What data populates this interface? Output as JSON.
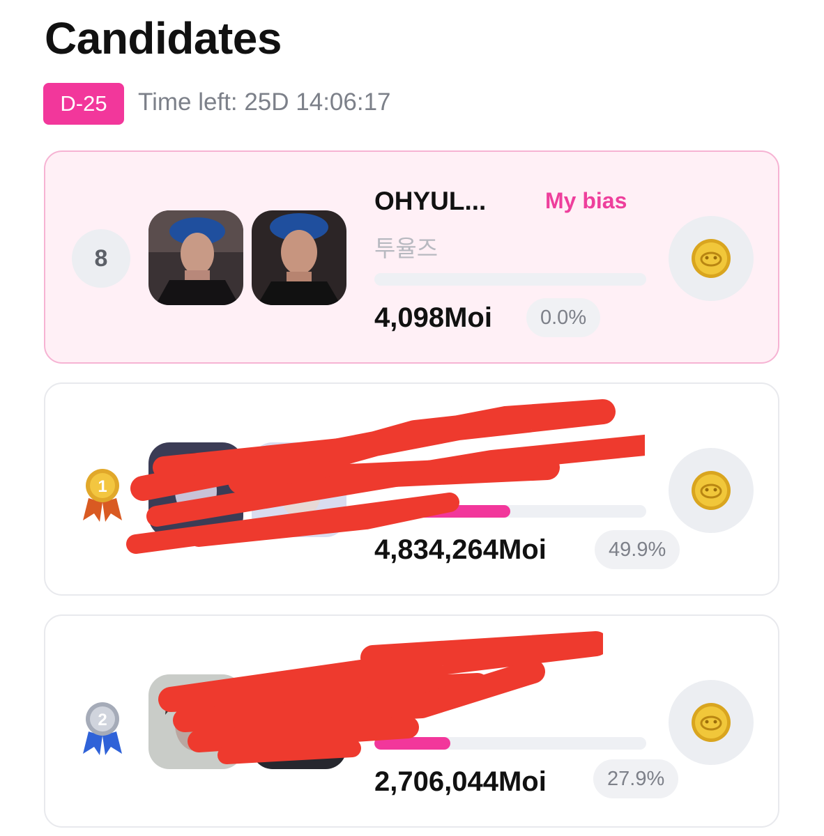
{
  "page": {
    "title": "Candidates"
  },
  "countdown": {
    "badge": "D-25",
    "time_left": "Time left: 25D 14:06:17"
  },
  "colors": {
    "accent": "#f2379b",
    "card_highlight_bg": "#fff0f6",
    "redaction": "#ee3a2e",
    "gold": "#e0b62a"
  },
  "candidates": [
    {
      "rank": "8",
      "name": "OHYUL...",
      "tag": "My bias",
      "group": "투율즈",
      "votes": "4,098Moi",
      "percent": "0.0%",
      "progress": 0.0,
      "highlight": true,
      "coin_icon": "coin-icon"
    },
    {
      "rank": "1",
      "medal": "gold-medal-icon",
      "name": "",
      "group": "",
      "votes": "4,834,264Moi",
      "percent": "49.9%",
      "progress": 0.499,
      "redacted": true,
      "coin_icon": "coin-icon"
    },
    {
      "rank": "2",
      "medal": "silver-medal-icon",
      "name": "",
      "group": "",
      "votes": "2,706,044Moi",
      "percent": "27.9%",
      "progress": 0.279,
      "redacted": true,
      "coin_icon": "coin-icon"
    }
  ]
}
